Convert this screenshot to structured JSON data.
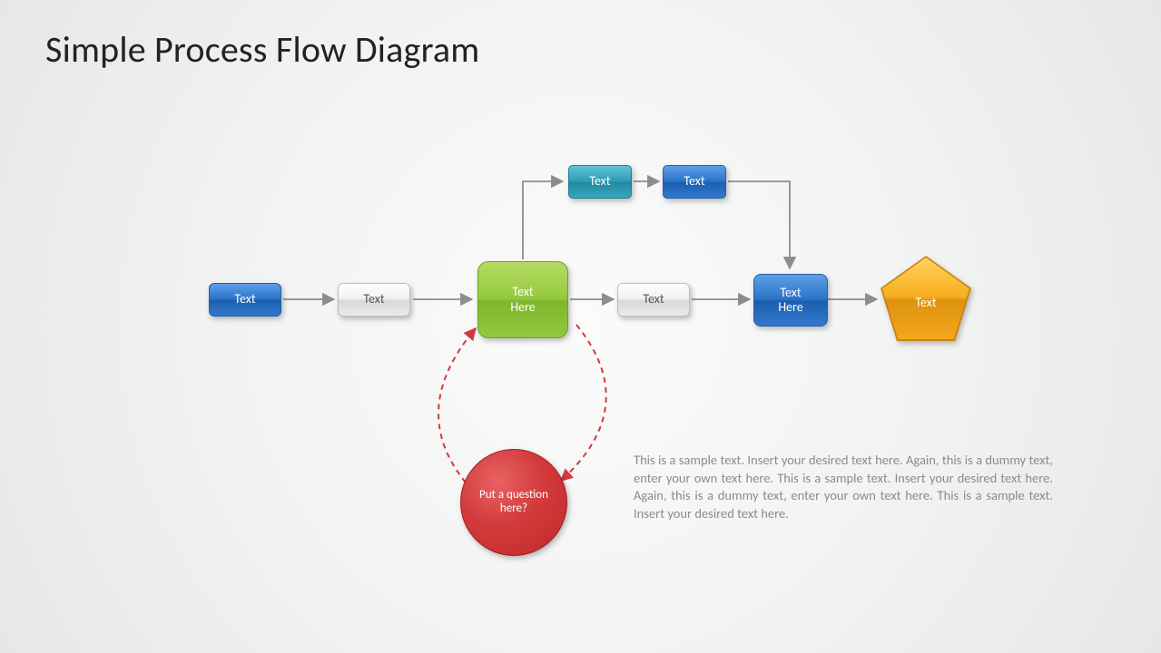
{
  "title": "Simple Process Flow Diagram",
  "nodes": {
    "n1": "Text",
    "n2": "Text",
    "n3": "Text\nHere",
    "n4": "Text",
    "n5": "Text\nHere",
    "n6": "Text",
    "nTopA": "Text",
    "nTopB": "Text",
    "question": "Put a question here?"
  },
  "description": "This is a sample text. Insert your desired text here. Again, this is a dummy text, enter your own text here. This is a sample text. Insert your desired text here. Again, this is a dummy text, enter your own text here. This is a sample text. Insert your desired text here."
}
